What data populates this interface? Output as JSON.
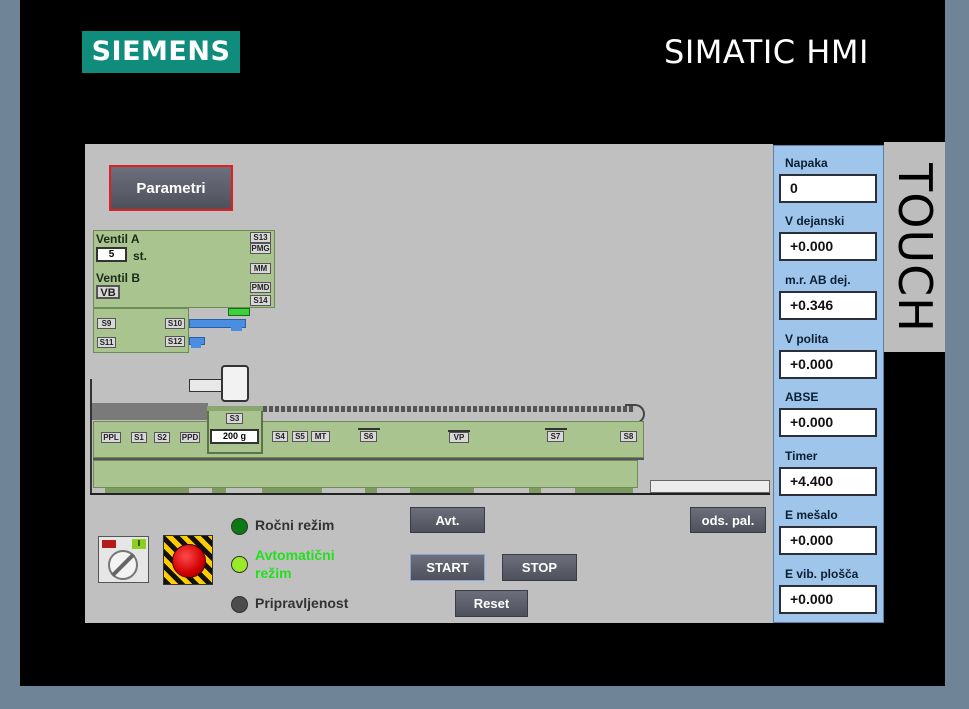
{
  "header": {
    "logo": "SIEMENS",
    "brand": "SIMATIC HMI",
    "touch": "TOUCH"
  },
  "screen": {
    "parametri_button": "Parametri",
    "ventil_a_label": "Ventil A",
    "ventil_a_value": "5",
    "ventil_a_unit": "st.",
    "ventil_b_label": "Ventil B",
    "ventil_b_value": "VB",
    "weight_value": "200 g",
    "tags": {
      "s13": "S13",
      "pmg": "PMG",
      "mm": "MM",
      "pmd": "PMD",
      "s14": "S14",
      "s9": "S9",
      "s10": "S10",
      "s11": "S11",
      "s12": "S12",
      "s3": "S3",
      "ppl": "PPL",
      "s1": "S1",
      "s2": "S2",
      "ppd": "PPD",
      "s4": "S4",
      "s5": "S5",
      "mt": "MT",
      "s6": "S6",
      "vp": "VP",
      "s7": "S7",
      "s8": "S8"
    },
    "buttons": {
      "avt": "Avt.",
      "ods_pal": "ods. pal.",
      "start": "START",
      "stop": "STOP",
      "reset": "Reset"
    },
    "lamps": {
      "rocni": {
        "label": "Ročni režim",
        "color": "#0b7a12"
      },
      "avtomaticni": {
        "label_line1": "Avtomatični",
        "label_line2": "režim",
        "color": "#9bea2a",
        "text_color": "#22e01c"
      },
      "pripravljenost": {
        "label": "Pripravljenost",
        "color": "#4c4c4c"
      }
    },
    "selector_indicator": "I"
  },
  "values_panel": [
    {
      "label": "Napaka",
      "value": "0"
    },
    {
      "label": "V dejanski",
      "value": "+0.000"
    },
    {
      "label": "m.r. AB dej.",
      "value": "+0.346"
    },
    {
      "label": "V polita",
      "value": "+0.000"
    },
    {
      "label": "ABSE",
      "value": "+0.000"
    },
    {
      "label": "Timer",
      "value": "+4.400"
    },
    {
      "label": "E mešalo",
      "value": "+0.000"
    },
    {
      "label": "E vib. plošča",
      "value": "+0.000"
    }
  ]
}
